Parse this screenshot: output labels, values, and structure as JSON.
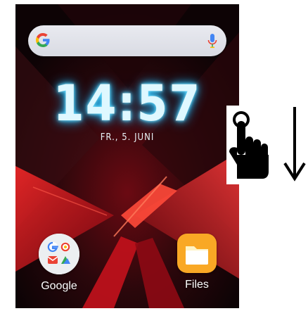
{
  "clock": {
    "time": "14:57",
    "date": "FR., 5. JUNI"
  },
  "search": {
    "logo_icon": "google-g-icon",
    "mic_icon": "microphone-icon"
  },
  "apps": [
    {
      "label": "Google",
      "icon": "google-folder-icon"
    },
    {
      "label": "Files",
      "icon": "files-folder-icon"
    }
  ],
  "gesture": {
    "hand_icon": "tap-hand-icon",
    "arrow_icon": "arrow-down-icon",
    "direction": "swipe-down"
  },
  "colors": {
    "wallpaper_dark": "#120407",
    "wallpaper_red": "#c3121c",
    "clock_glow": "#37c7ff",
    "files_yellow": "#f9a825"
  }
}
